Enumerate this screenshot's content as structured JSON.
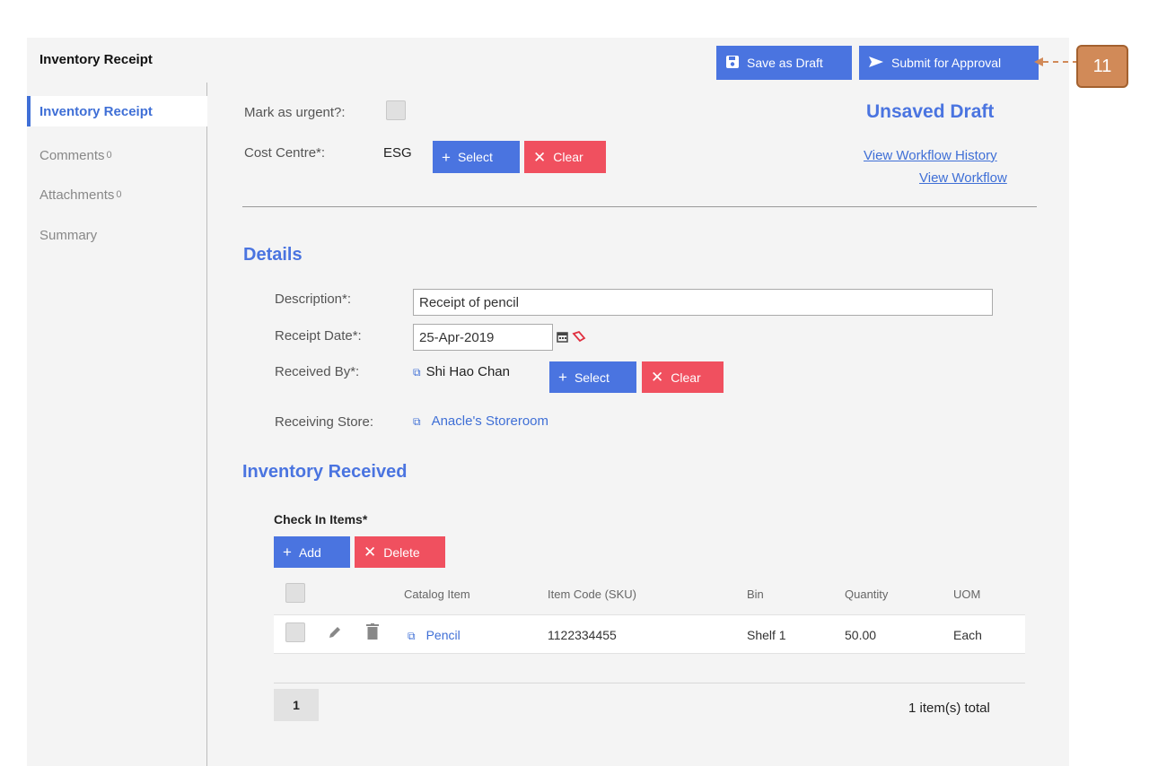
{
  "app": {
    "title": "Inventory Receipt"
  },
  "toolbar": {
    "save_draft_label": "Save as Draft",
    "submit_label": "Submit for Approval"
  },
  "callout": {
    "number": "11"
  },
  "sidebar": {
    "items": [
      {
        "label": "Inventory Receipt"
      },
      {
        "label": "Comments",
        "count": "0"
      },
      {
        "label": "Attachments",
        "count": "0"
      },
      {
        "label": "Summary"
      }
    ]
  },
  "header": {
    "urgent_label": "Mark as urgent?:",
    "status": "Unsaved Draft",
    "cost_centre_label": "Cost Centre*:",
    "cost_centre_value": "ESG",
    "select_label": "Select",
    "clear_label": "Clear",
    "workflow_history_link": "View Workflow History",
    "workflow_link": "View Workflow"
  },
  "details": {
    "heading": "Details",
    "description_label": "Description*:",
    "description_value": "Receipt of pencil",
    "receipt_date_label": "Receipt Date*:",
    "receipt_date_value": "25-Apr-2019",
    "received_by_label": "Received By*:",
    "received_by_value": "Shi Hao Chan",
    "select_label": "Select",
    "clear_label": "Clear",
    "receiving_store_label": "Receiving Store:",
    "receiving_store_value": "Anacle's Storeroom"
  },
  "inventory": {
    "heading": "Inventory Received",
    "subheading": "Check In Items*",
    "add_label": "Add",
    "delete_label": "Delete",
    "columns": [
      "Catalog Item",
      "Item Code (SKU)",
      "Bin",
      "Quantity",
      "UOM"
    ],
    "rows": [
      {
        "catalog_item": "Pencil",
        "sku": "1122334455",
        "bin": "Shelf 1",
        "quantity": "50.00",
        "uom": "Each"
      }
    ],
    "page_number": "1",
    "total": "1 item(s) total"
  },
  "icons": {
    "save": "floppy-icon",
    "submit": "send-icon",
    "plus": "plus-icon",
    "close": "x-icon",
    "calendar": "calendar-icon",
    "eraser": "eraser-icon",
    "external": "external-link-icon",
    "edit": "pencil-icon",
    "delete": "trash-icon"
  },
  "colors": {
    "accent": "#4a74e0",
    "danger": "#f0505f",
    "callout": "#d18a58"
  }
}
